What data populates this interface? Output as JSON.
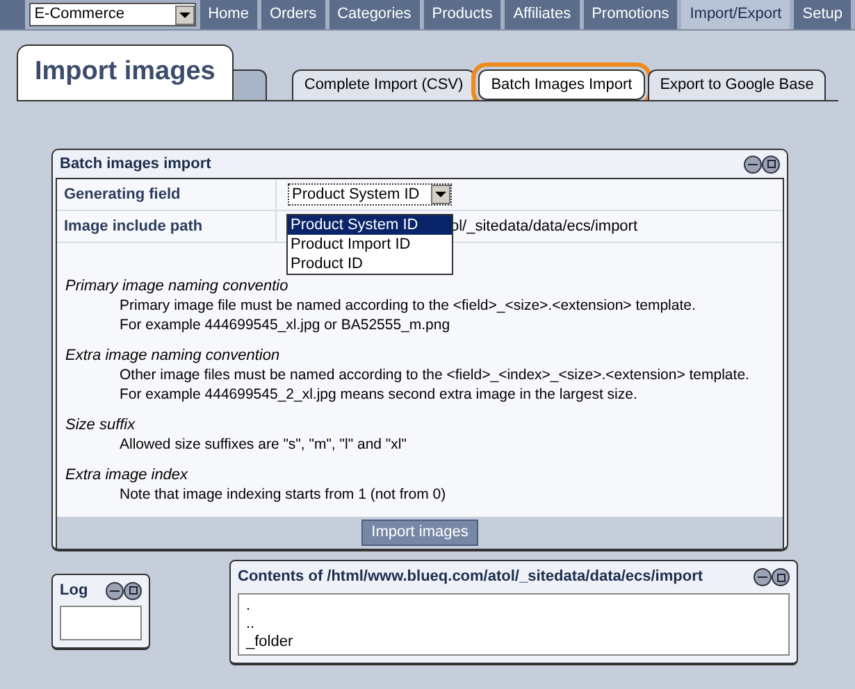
{
  "store_select": {
    "value": "E-Commerce"
  },
  "nav": [
    {
      "label": "Home",
      "selected": false
    },
    {
      "label": "Orders",
      "selected": false
    },
    {
      "label": "Categories",
      "selected": false
    },
    {
      "label": "Products",
      "selected": false
    },
    {
      "label": "Affiliates",
      "selected": false
    },
    {
      "label": "Promotions",
      "selected": false
    },
    {
      "label": "Import/Export",
      "selected": true
    },
    {
      "label": "Setup",
      "selected": false
    }
  ],
  "page_title": "Import images",
  "tabs": [
    {
      "label": "Complete Import (CSV)",
      "selected": false,
      "highlighted": false
    },
    {
      "label": "Batch Images Import",
      "selected": true,
      "highlighted": true
    },
    {
      "label": "Export to Google Base",
      "selected": false,
      "highlighted": false
    }
  ],
  "batch_panel": {
    "title": "Batch images import",
    "generating_field": {
      "label": "Generating field",
      "value": "Product System ID",
      "expanded": true,
      "options": [
        {
          "label": "Product System ID",
          "selected": true
        },
        {
          "label": "Product Import ID",
          "selected": false
        },
        {
          "label": "Product ID",
          "selected": false
        }
      ]
    },
    "include_path": {
      "label": "Image include path",
      "value": "ol/_sitedata/data/ecs/import"
    },
    "notes": [
      {
        "heading": "Primary image naming conventio",
        "lines": [
          "Primary image file must be named according to the <field>_<size>.<extension> template.",
          "For example 444699545_xl.jpg or BA52555_m.png"
        ]
      },
      {
        "heading": "Extra image naming convention",
        "lines": [
          "Other image files must be named according to the <field>_<index>_<size>.<extension> template.",
          "For example 444699545_2_xl.jpg means second extra image in the largest size."
        ]
      },
      {
        "heading": "Size suffix",
        "lines": [
          "Allowed size suffixes are \"s\", \"m\", \"l\" and \"xl\""
        ]
      },
      {
        "heading": "Extra image index",
        "lines": [
          "Note that image indexing starts from 1 (not from 0)"
        ]
      }
    ],
    "button": "Import images"
  },
  "log_panel": {
    "title": "Log"
  },
  "contents_panel": {
    "title": "Contents of /html/www.blueq.com/atol/_sitedata/data/ecs/import",
    "entries": [
      ".",
      "..",
      "_folder"
    ]
  }
}
